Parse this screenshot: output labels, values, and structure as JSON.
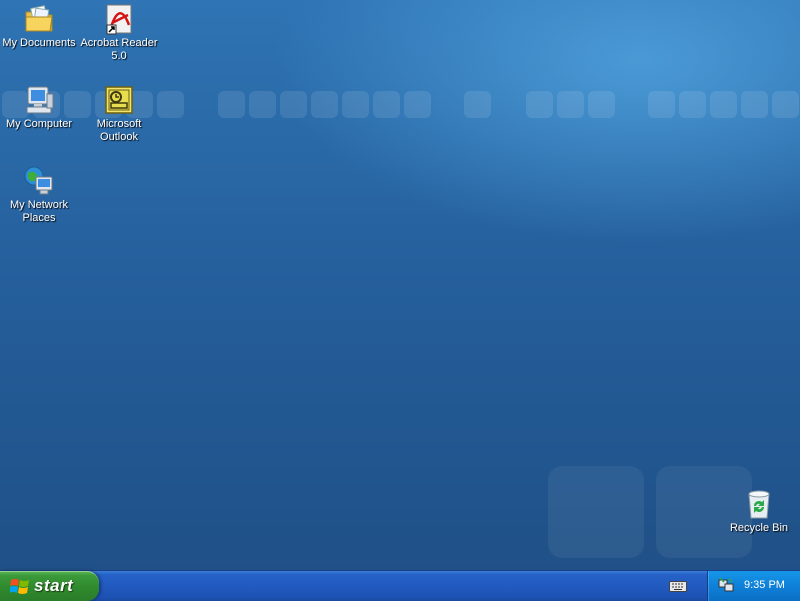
{
  "desktop": {
    "icons": [
      {
        "label": "My Documents",
        "icon": "my-documents-folder-icon"
      },
      {
        "label": "Acrobat Reader 5.0",
        "icon": "acrobat-reader-icon"
      },
      {
        "label": "My Computer",
        "icon": "my-computer-icon"
      },
      {
        "label": "Microsoft Outlook",
        "icon": "outlook-icon"
      },
      {
        "label": "My Network Places",
        "icon": "network-places-icon"
      },
      {
        "label": "Recycle Bin",
        "icon": "recycle-bin-icon"
      }
    ]
  },
  "taskbar": {
    "start_label": "start",
    "tray": {
      "clock": "9:35 PM"
    }
  },
  "colors": {
    "desktop_bg": "#255f9c",
    "taskbar": "#225ac0",
    "start_button": "#2f8a2d",
    "tray": "#0f80d8"
  }
}
